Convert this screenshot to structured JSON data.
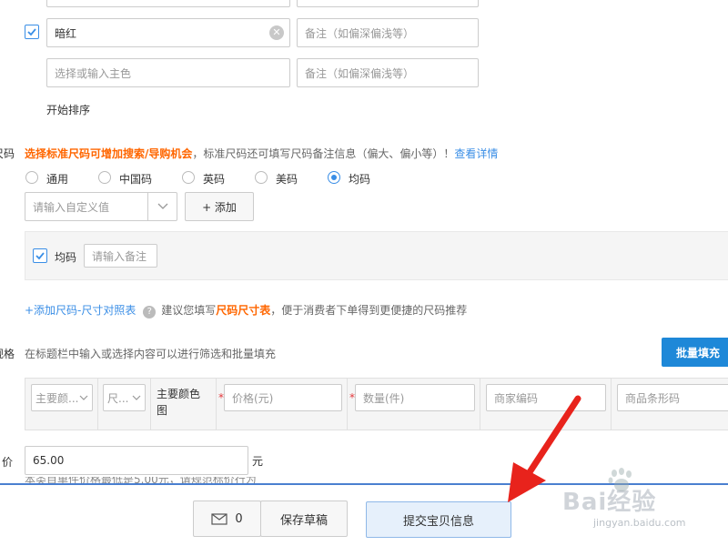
{
  "color_section": {
    "row1": {
      "checked": true,
      "color_value": "暗红",
      "remark_placeholder": "备注（如偏深偏浅等）"
    },
    "row2": {
      "color_placeholder": "选择或输入主色",
      "remark_placeholder": "备注（如偏深偏浅等）"
    },
    "start_sort": "开始排序"
  },
  "size_section": {
    "label_partial": "尺码",
    "hint_orange": "选择标准尺码可增加搜索/导购机会",
    "hint_gray": "，标准尺码还可填写尺码备注信息（偏大、偏小等）！",
    "hint_link": "查看详情",
    "options": [
      "通用",
      "中国码",
      "英码",
      "美码",
      "均码"
    ],
    "selected_option": "均码",
    "custom_placeholder": "请输入自定义值",
    "add_button": "+ 添加",
    "panel": {
      "checkbox_label": "均码",
      "remark_placeholder": "请输入备注"
    },
    "size_chart_link": "+添加尺码-尺寸对照表",
    "size_chart_hint_pre": "建议您填写",
    "size_chart_hint_em": "尺码尺寸表",
    "size_chart_hint_post": "，便于消费者下单得到更便捷的尺码推荐"
  },
  "spec_section": {
    "label_partial": "规格",
    "hint": "在标题栏中输入或选择内容可以进行筛选和批量填充",
    "batch_button": "批量填充",
    "headers": {
      "main_color_select": "主要颜...",
      "size_select": "尺...",
      "main_color_image": "主要颜色图",
      "price_placeholder": "价格(元)",
      "quantity_placeholder": "数量(件)",
      "merchant_code_placeholder": "商家编码",
      "barcode_placeholder": "商品条形码"
    }
  },
  "price_section": {
    "label_partial": "价",
    "value": "65.00",
    "unit": "元",
    "note_partial": "本类目单件价格最低是5.00元，请规范标价行为"
  },
  "footer": {
    "message_count": "0",
    "save_draft": "保存草稿",
    "submit": "提交宝贝信息"
  },
  "watermark": {
    "brand": "Bai经验",
    "url": "jingyan.baidu.com"
  },
  "colors": {
    "accent": "#3a8ee6",
    "orange": "#ff6600",
    "batch_button": "#1e88d8",
    "arrow": "#e8231c"
  }
}
